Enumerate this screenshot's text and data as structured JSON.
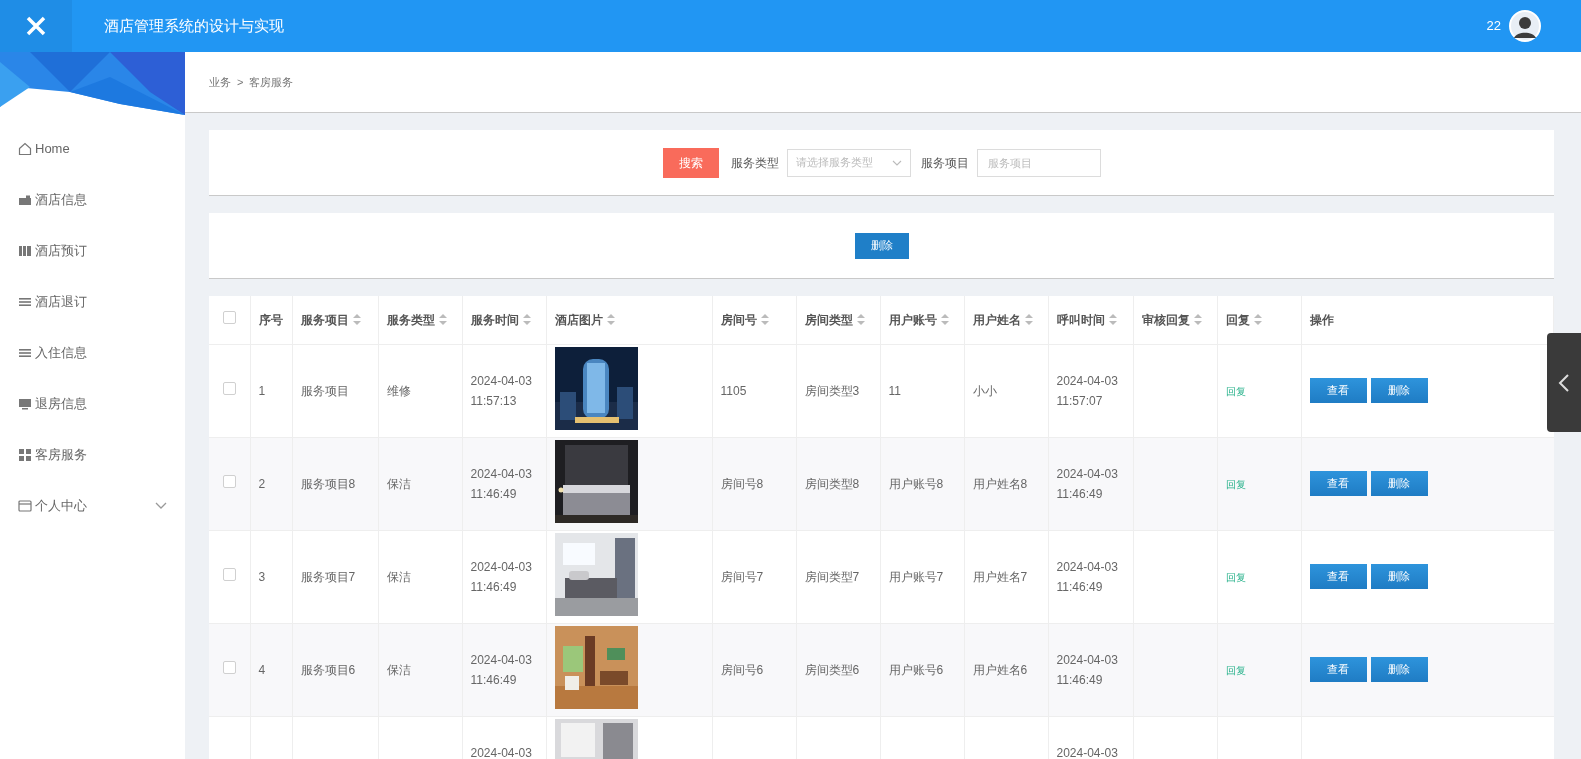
{
  "header": {
    "title": "酒店管理系统的设计与实现",
    "user": "22"
  },
  "sidebar": {
    "items": [
      {
        "label": "Home",
        "kind": "home",
        "expandable": false
      },
      {
        "label": "酒店信息",
        "kind": "briefcase",
        "expandable": false
      },
      {
        "label": "酒店预订",
        "kind": "book",
        "expandable": false
      },
      {
        "label": "酒店退订",
        "kind": "list",
        "expandable": false
      },
      {
        "label": "入住信息",
        "kind": "list",
        "expandable": false
      },
      {
        "label": "退房信息",
        "kind": "monitor",
        "expandable": false
      },
      {
        "label": "客房服务",
        "kind": "grid",
        "expandable": false
      },
      {
        "label": "个人中心",
        "kind": "card",
        "expandable": true
      }
    ]
  },
  "breadcrumb": {
    "items": [
      "业务",
      "客房服务"
    ],
    "separator": ">"
  },
  "search": {
    "button": "搜索",
    "fields": [
      {
        "label": "服务类型",
        "placeholder": "请选择服务类型",
        "kind": "select"
      },
      {
        "label": "服务项目",
        "placeholder": "服务项目",
        "kind": "input"
      }
    ]
  },
  "toolbar": {
    "delete_button": "删除"
  },
  "table": {
    "select_all": false,
    "columns": [
      {
        "label": "序号",
        "sortable": false
      },
      {
        "label": "服务项目",
        "sortable": true
      },
      {
        "label": "服务类型",
        "sortable": true
      },
      {
        "label": "服务时间",
        "sortable": true
      },
      {
        "label": "酒店图片",
        "sortable": true
      },
      {
        "label": "房间号",
        "sortable": true
      },
      {
        "label": "房间类型",
        "sortable": true
      },
      {
        "label": "用户账号",
        "sortable": true
      },
      {
        "label": "用户姓名",
        "sortable": true
      },
      {
        "label": "呼叫时间",
        "sortable": true
      },
      {
        "label": "审核回复",
        "sortable": true
      },
      {
        "label": "回复",
        "sortable": true
      },
      {
        "label": "操作",
        "sortable": false
      }
    ],
    "rows": [
      {
        "checked": false,
        "index": "1",
        "item": "服务项目",
        "type": "维修",
        "service_date": "2024-04-03",
        "service_time": "11:57:13",
        "room_no": "1105",
        "room_type": "房间类型3",
        "account": "11",
        "name": "小小",
        "call_date": "2024-04-03",
        "call_time": "11:57:07",
        "reply": "回复",
        "actions": [
          "查看",
          "删除"
        ]
      },
      {
        "checked": false,
        "index": "2",
        "item": "服务项目8",
        "type": "保洁",
        "service_date": "2024-04-03",
        "service_time": "11:46:49",
        "room_no": "房间号8",
        "room_type": "房间类型8",
        "account": "用户账号8",
        "name": "用户姓名8",
        "call_date": "2024-04-03",
        "call_time": "11:46:49",
        "reply": "回复",
        "actions": [
          "查看",
          "删除"
        ]
      },
      {
        "checked": false,
        "index": "3",
        "item": "服务项目7",
        "type": "保洁",
        "service_date": "2024-04-03",
        "service_time": "11:46:49",
        "room_no": "房间号7",
        "room_type": "房间类型7",
        "account": "用户账号7",
        "name": "用户姓名7",
        "call_date": "2024-04-03",
        "call_time": "11:46:49",
        "reply": "回复",
        "actions": [
          "查看",
          "删除"
        ]
      },
      {
        "checked": false,
        "index": "4",
        "item": "服务项目6",
        "type": "保洁",
        "service_date": "2024-04-03",
        "service_time": "11:46:49",
        "room_no": "房间号6",
        "room_type": "房间类型6",
        "account": "用户账号6",
        "name": "用户姓名6",
        "call_date": "2024-04-03",
        "call_time": "11:46:49",
        "reply": "回复",
        "actions": [
          "查看",
          "删除"
        ]
      },
      {
        "service_date": "2024-04-03",
        "call_date": "2024-04-03"
      }
    ]
  }
}
